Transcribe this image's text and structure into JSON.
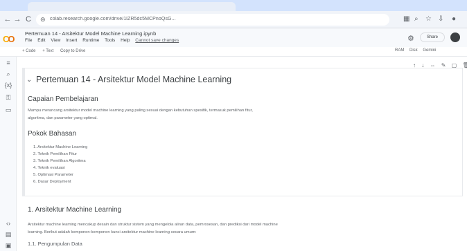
{
  "browser": {
    "url": "colab.research.google.com/drive/1lZR5dc5MCPnoQsG...",
    "nav": {
      "back": "←",
      "forward": "→",
      "reload": "C"
    }
  },
  "colab": {
    "logo": "CO",
    "notebook_title": "Pertemuan 14 - Arsitektur Model Machine Learning.ipynb",
    "menu": [
      "File",
      "Edit",
      "View",
      "Insert",
      "Runtime",
      "Tools",
      "Help"
    ],
    "saved_status": "Cannot save changes",
    "share_label": "Share"
  },
  "toolbar": {
    "code": "+ Code",
    "text": "+ Text",
    "copy_to_drive": "Copy to Drive",
    "runtime": [
      "RAM",
      "Disk",
      "Gemini"
    ]
  },
  "sidebar": [
    "toc-icon",
    "search-icon",
    "variables-icon",
    "key-icon",
    "files-icon"
  ],
  "sidebar_bottom": [
    "code-snippets-icon",
    "command-palette-icon",
    "terminal-icon"
  ],
  "cell_tools": [
    "↑",
    "↓",
    "⇔",
    "✎",
    "▢",
    "🗑"
  ],
  "content": {
    "main_title": "Pertemuan 14 - Arsitektur Model Machine Learning",
    "section1_title": "Capaian Pembelajaran",
    "section1_text_1": "Mampu merancang arsitektur model machine learning yang paling sesuai dengan kebutuhan spesifik, termasuk pemilihan fitur,",
    "section1_text_2": "algoritma, dan parameter yang optimal.",
    "section2_title": "Pokok Bahasan",
    "topics": [
      "1. Arsitektur Machine Learning",
      "2. Teknik Pemilihan Fitur",
      "3. Teknik Pemilihan Algoritma",
      "4. Teknik evaluasi",
      "5. Optimasi Parameter",
      "6. Dasar Deployment"
    ],
    "section3_title": "1. Arsitektur Machine Learning",
    "section3_text_1": "Arsitektur machine learning mencakup desain dan struktur sistem yang mengelola aliran data, pemrosesan, dan prediksi dari model machine",
    "section3_text_2": "learning. Berikut adalah komponen-komponen kunci arsitektur machine learning secara umum:",
    "subsection_title": "1.1. Pengumpulan Data"
  }
}
